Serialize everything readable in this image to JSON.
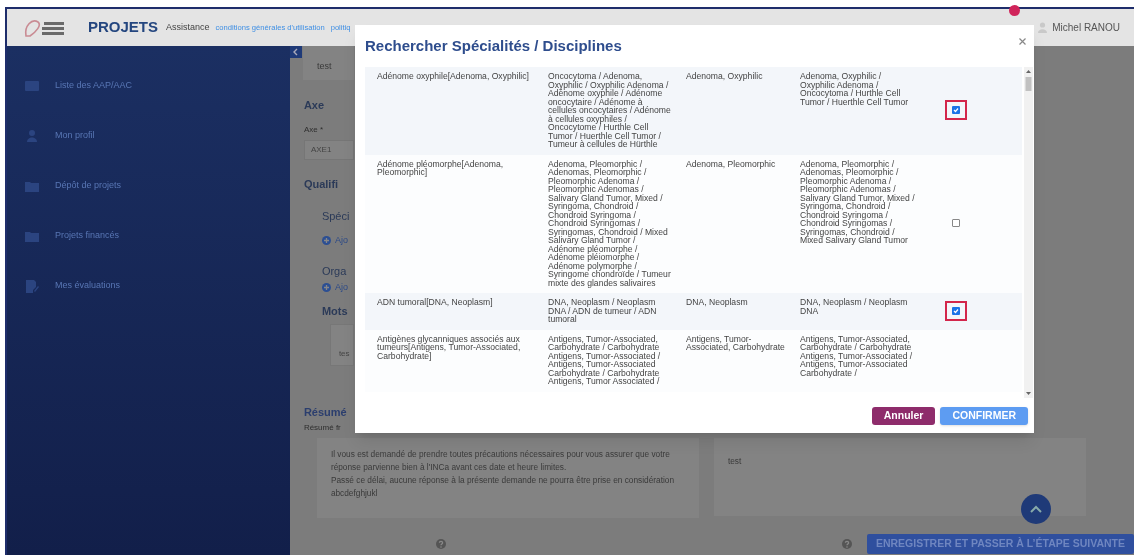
{
  "header": {
    "app_name": "PROJETS",
    "links": [
      {
        "label": "Assistance",
        "kind": "plain"
      },
      {
        "label": "conditions générales d'utilisation",
        "kind": "link"
      },
      {
        "label": "politiq",
        "kind": "link"
      }
    ],
    "user": "Michel RANOU"
  },
  "sidebar": {
    "items": [
      {
        "label": "Liste des AAP/AAC",
        "kind": "list"
      },
      {
        "label": "Mon profil",
        "kind": "person"
      },
      {
        "label": "Dépôt de projets",
        "kind": "folder"
      },
      {
        "label": "Projets financés",
        "kind": "euro"
      },
      {
        "label": "Mes évaluations",
        "kind": "edit"
      }
    ]
  },
  "form": {
    "top_value": "test",
    "axe_heading": "Axe",
    "axe_label": "Axe *",
    "axe_value": "AXE1",
    "qualif_heading": "Qualifi",
    "specialites_heading": "Spéci",
    "specialites_add": "Ajo",
    "organes_heading": "Orga",
    "organes_add": "Ajo",
    "mots_heading": "Mots",
    "mots_value": "tes",
    "resume_heading": "Résumé",
    "resume_label": "Résumé fr",
    "resume_text": [
      "Il vous est demandé de prendre toutes précautions nécessaires pour vous assurer que votre réponse parvienne bien à l'INCa avant ces date et heure limites.",
      "Passé ce délai, aucune réponse à la présente demande ne pourra être prise en considération abcdefghjukl"
    ],
    "resume_right": "test"
  },
  "footer": {
    "next_button": "ENREGISTRER ET PASSER À L’ÉTAPE SUIVANTE"
  },
  "modal": {
    "title": "Rechercher Spécialités / Disciplines",
    "rows": [
      {
        "column_1": "Adénome oxyphile[Adenoma, Oxyphilic]",
        "column_2": "Oncocytoma / Adenoma, Oxyphilic / Oxyphilic Adenoma / Adénome oxyphile / Adénome oncocytaire / Adénome à cellules oncocytaires / Adénome à cellules oxyphiles / Oncocytome / Hurthle Cell Tumor / Huerthle Cell Tumor / Tumeur à cellules de Hürthle",
        "column_3": "Adenoma, Oxyphilic",
        "column_4": "Adenoma, Oxyphilic / Oxyphilic Adenoma / Oncocytoma / Hurthle Cell Tumor / Huerthle Cell Tumor",
        "checked": true
      },
      {
        "column_1": "Adénome pléomorphe[Adenoma, Pleomorphic]",
        "column_2": "Adenoma, Pleomorphic / Adenomas, Pleomorphic / Pleomorphic Adenoma / Pleomorphic Adenomas / Salivary Gland Tumor, Mixed / Syringoma, Chondroid / Chondroid Syringoma / Chondroid Syringomas / Syringomas, Chondroid / Mixed Salivary Gland Tumor / Adénome pléomorphe / Adénome pléiomorphe / Adénome polymorphe / Syringome chondroïde / Tumeur mixte des glandes salivaires",
        "column_3": "Adenoma, Pleomorphic",
        "column_4": "Adenoma, Pleomorphic / Adenomas, Pleomorphic / Pleomorphic Adenoma / Pleomorphic Adenomas / Salivary Gland Tumor, Mixed / Syringoma, Chondroid / Chondroid Syringoma / Chondroid Syringomas / Syringomas, Chondroid / Mixed Salivary Gland Tumor",
        "checked": false
      },
      {
        "column_1": "ADN tumoral[DNA, Neoplasm]",
        "column_2": "DNA, Neoplasm / Neoplasm DNA / ADN de tumeur / ADN tumoral",
        "column_3": "DNA, Neoplasm",
        "column_4": "DNA, Neoplasm / Neoplasm DNA",
        "checked": true
      },
      {
        "column_1": "Antigènes glycanniques associés aux tumeurs[Antigens, Tumor-Associated, Carbohydrate]",
        "column_2": "Antigens, Tumor-Associated, Carbohydrate / Carbohydrate Antigens, Tumor-Associated / Antigens, Tumor-Associated Carbohydrate / Carbohydrate Antigens, Tumor Associated /",
        "column_3": "Antigens, Tumor-Associated, Carbohydrate",
        "column_4": "Antigens, Tumor-Associated, Carbohydrate / Carbohydrate Antigens, Tumor-Associated / Antigens, Tumor-Associated Carbohydrate /"
      }
    ],
    "buttons": [
      {
        "label": "Annuler",
        "kind": "cancel"
      },
      {
        "label": "CONFIRMER",
        "kind": "confirm"
      }
    ]
  }
}
